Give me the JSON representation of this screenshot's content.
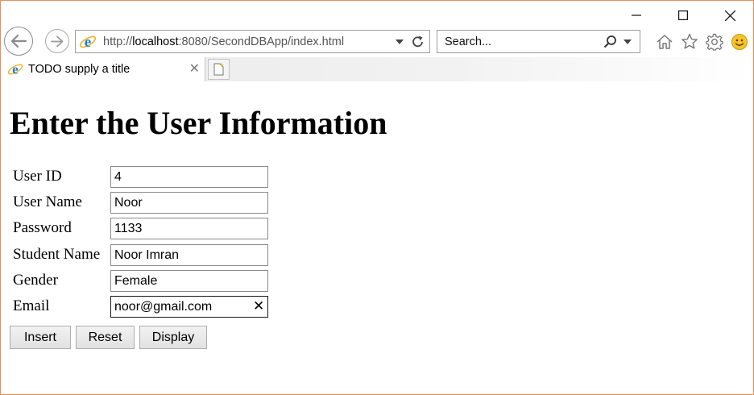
{
  "window": {
    "controls": {
      "minimize": "minimize",
      "maximize": "maximize",
      "close": "close"
    }
  },
  "address_bar": {
    "url_prefix": "http://",
    "url_host": "localhost",
    "url_rest": ":8080/SecondDBApp/index.html"
  },
  "search": {
    "placeholder": "Search..."
  },
  "toolbar": {
    "icons": [
      "home-icon",
      "favorites-star-icon",
      "settings-gear-icon",
      "smiley-feedback-icon"
    ]
  },
  "tab": {
    "title": "TODO supply a title"
  },
  "page": {
    "heading": "Enter the User Information",
    "fields": [
      {
        "label": "User ID",
        "value": "4"
      },
      {
        "label": "User Name",
        "value": "Noor"
      },
      {
        "label": "Password",
        "value": "1133"
      },
      {
        "label": "Student Name",
        "value": "Noor Imran"
      },
      {
        "label": "Gender",
        "value": "Female"
      },
      {
        "label": "Email",
        "value": "noor@gmail.com"
      }
    ],
    "buttons": {
      "insert": "Insert",
      "reset": "Reset",
      "display": "Display"
    }
  },
  "colors": {
    "window_border": "#e2915a",
    "ie_blue": "#1e7fd8",
    "ie_ring": "#f0b323"
  }
}
